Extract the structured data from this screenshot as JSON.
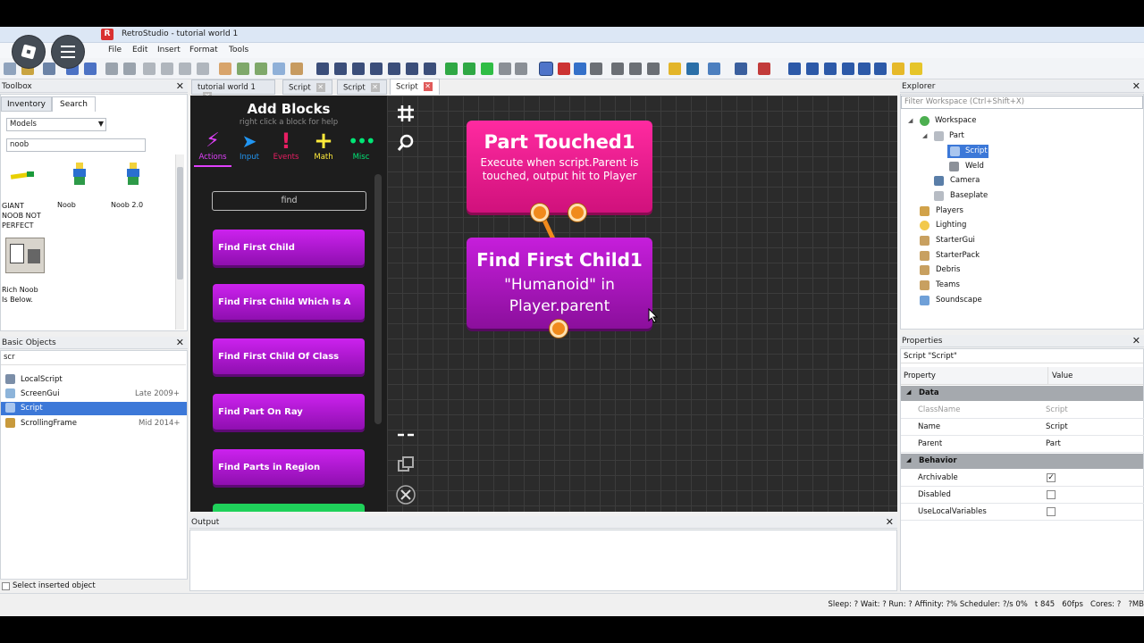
{
  "window": {
    "title": "RetroStudio - tutorial world 1",
    "logo": "R"
  },
  "menu": [
    "File",
    "Edit",
    "Insert",
    "Format",
    "Tools"
  ],
  "overlay": {
    "roblox": "roblox-logo-icon",
    "menu": "hamburger-icon"
  },
  "toolbox": {
    "title": "Toolbox",
    "tabs": [
      "Inventory",
      "Search"
    ],
    "category": "Models",
    "search": "noob",
    "items": [
      {
        "label": "GIANT NOOB NOT PERFECT"
      },
      {
        "label": "Noob"
      },
      {
        "label": "Noob 2.0"
      },
      {
        "label": "Rich Noob Is Below."
      }
    ]
  },
  "basic": {
    "title": "Basic Objects",
    "search": "scr",
    "items": [
      {
        "name": "LocalScript",
        "note": ""
      },
      {
        "name": "ScreenGui",
        "note": "Late 2009+"
      },
      {
        "name": "Script",
        "note": ""
      },
      {
        "name": "ScrollingFrame",
        "note": "Mid 2014+"
      }
    ],
    "select_inserted": "Select inserted object"
  },
  "tabs": [
    {
      "label": "tutorial world 1"
    },
    {
      "label": "Script"
    },
    {
      "label": "Script"
    },
    {
      "label": "Script"
    }
  ],
  "addblocks": {
    "title": "Add Blocks",
    "subtitle": "right click a block for help",
    "categories": [
      {
        "label": "Actions",
        "color": "#e040fb"
      },
      {
        "label": "Input",
        "color": "#2196f3"
      },
      {
        "label": "Events",
        "color": "#e91e63"
      },
      {
        "label": "Math",
        "color": "#ffeb3b"
      },
      {
        "label": "Misc",
        "color": "#00e676"
      }
    ],
    "search": "find",
    "blocks": [
      "Find First Child",
      "Find First Child Which Is A",
      "Find First Child Of Class",
      "Find Part On Ray",
      "Find Parts in Region"
    ]
  },
  "editor_tools": {
    "grid": "grid-icon",
    "zoom": "magnifier-icon",
    "collapse": "collapse-icon",
    "duplicate": "duplicate-icon",
    "delete": "close-icon"
  },
  "nodes": {
    "touched": {
      "title": "Part Touched1",
      "body": "Execute when script.Parent is touched, output hit to Player"
    },
    "findchild": {
      "title": "Find First Child1",
      "body": "\"Humanoid\" in Player.parent"
    }
  },
  "output": {
    "title": "Output"
  },
  "explorer": {
    "title": "Explorer",
    "filter_placeholder": "Filter Workspace (Ctrl+Shift+X)",
    "items": [
      "Workspace",
      "Part",
      "Script",
      "Weld",
      "Camera",
      "Baseplate",
      "Players",
      "Lighting",
      "StarterGui",
      "StarterPack",
      "Debris",
      "Teams",
      "Soundscape"
    ]
  },
  "properties": {
    "title": "Properties",
    "selected": "Script \"Script\"",
    "col_property": "Property",
    "col_value": "Value",
    "sections": {
      "data": "Data",
      "behavior": "Behavior"
    },
    "data_rows": [
      {
        "k": "ClassName",
        "v": "Script"
      },
      {
        "k": "Name",
        "v": "Script"
      },
      {
        "k": "Parent",
        "v": "Part"
      }
    ],
    "behavior_rows": [
      {
        "k": "Archivable",
        "checked": true
      },
      {
        "k": "Disabled",
        "checked": false
      },
      {
        "k": "UseLocalVariables",
        "checked": false
      }
    ]
  },
  "status": "Sleep: ? Wait: ? Run: ? Affinity: ?% Scheduler: ?/s 0%   t 845   60fps   Cores: ?   ?MB"
}
